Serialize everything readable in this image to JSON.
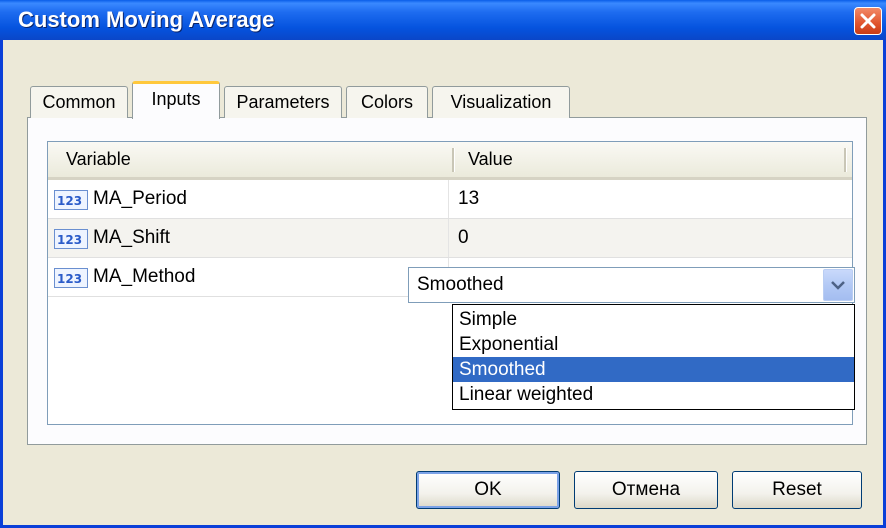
{
  "window": {
    "title": "Custom Moving Average"
  },
  "tabs": [
    {
      "label": "Common"
    },
    {
      "label": "Inputs"
    },
    {
      "label": "Parameters"
    },
    {
      "label": "Colors"
    },
    {
      "label": "Visualization"
    }
  ],
  "active_tab": "Inputs",
  "grid": {
    "columns": [
      "Variable",
      "Value"
    ],
    "rows": [
      {
        "icon": "integer-type-icon",
        "name": "MA_Period",
        "value": "13"
      },
      {
        "icon": "integer-type-icon",
        "name": "MA_Shift",
        "value": "0"
      },
      {
        "icon": "integer-type-icon",
        "name": "MA_Method",
        "value": "Smoothed"
      }
    ]
  },
  "dropdown": {
    "options": [
      "Simple",
      "Exponential",
      "Smoothed",
      "Linear weighted"
    ],
    "selected": "Smoothed"
  },
  "buttons": {
    "ok": "OK",
    "cancel": "Отмена",
    "reset": "Reset"
  },
  "colors": {
    "title_bar": "#0a5de8",
    "selection": "#316ac5",
    "active_tab_accent": "#ffc83c"
  }
}
